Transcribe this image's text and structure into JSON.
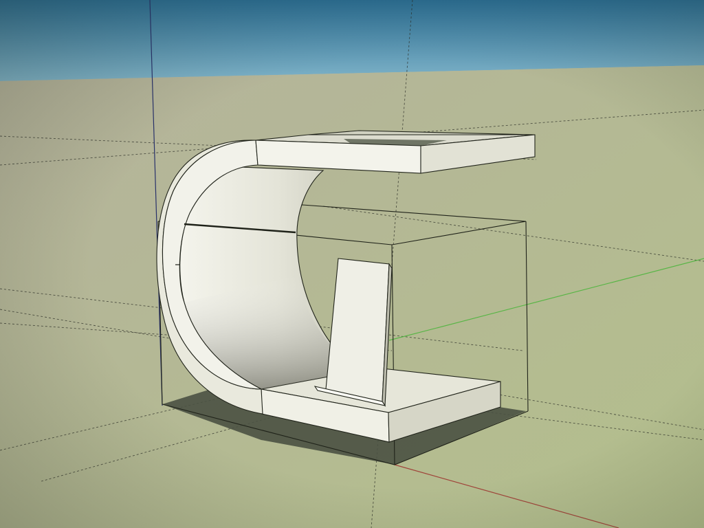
{
  "app": {
    "view": "3d-modeling-viewport",
    "scene_description_label": ""
  },
  "colors": {
    "sky_top": "#2a6f96",
    "sky_bottom": "#7fb3c8",
    "ground_far": "#b5b39c",
    "ground_near": "#b3bf8c",
    "face_light": "#ececdf",
    "face_mid": "#d9d9c9",
    "edge": "#1f2219",
    "shadow": "#4a5142",
    "axis_blue": "#27306a",
    "axis_green": "#57b545",
    "axis_red": "#a0443a",
    "guide_dashed": "#2b2d26"
  },
  "axes": {
    "show_blue_vertical": true,
    "show_green": true,
    "show_red": true,
    "show_guides": true
  },
  "model": {
    "name": "",
    "components": [
      "curved-wrap-panel",
      "top-shelf",
      "bottom-base-slab",
      "tilted-stand-plate",
      "bounding-box"
    ]
  }
}
